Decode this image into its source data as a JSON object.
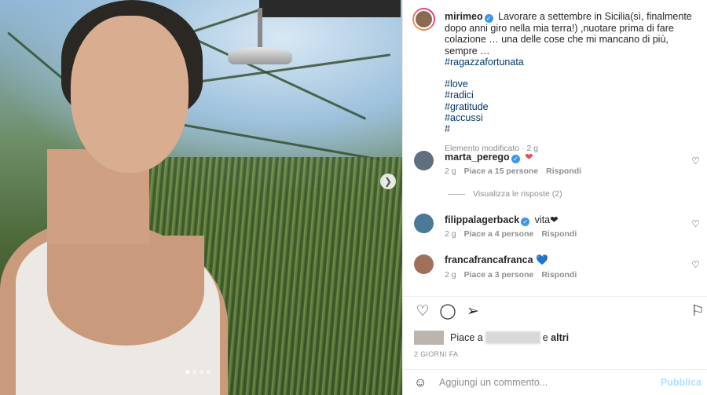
{
  "media": {
    "next_icon": "chevron-right-icon",
    "carousel": {
      "count": 4,
      "active_index": 0
    }
  },
  "caption": {
    "username": "mirimeo",
    "text": "Lavorare a settembre in Sicilia(sì, finalmente dopo anni giro nella mia terra!) ,nuotare prima di fare colazione … una delle cose che mi mancano di più, sempre …",
    "tag_main": "#ragazzafortunata",
    "hashtags": [
      "#love",
      "#radici",
      "#gratitude",
      "#accussi",
      "#"
    ],
    "edited": "Elemento modificato · 2 g"
  },
  "comments": [
    {
      "username": "marta_perego",
      "text": "❤",
      "time": "2 g",
      "likes": "Piace a 15 persone",
      "reply": "Rispondi"
    },
    {
      "username": "filippalagerback",
      "text": "vita❤",
      "time": "2 g",
      "likes": "Piace a 4 persone",
      "reply": "Rispondi"
    },
    {
      "username": "francafrancafranca",
      "text": "💙",
      "time": "2 g",
      "likes": "Piace a 3 persone",
      "reply": "Rispondi"
    }
  ],
  "view_replies": "Visualizza le risposte (2)",
  "actions": {
    "like_icon": "heart-icon",
    "comment_icon": "comment-icon",
    "share_icon": "send-icon",
    "save_icon": "bookmark-icon"
  },
  "likes_summary": {
    "prefix": "Piace a",
    "middle": "e",
    "suffix": "altri"
  },
  "posted": "2 GIORNI FA",
  "add_comment": {
    "placeholder": "Aggiungi un commento...",
    "publish": "Pubblica"
  },
  "colors": {
    "link": "#00376b",
    "verified": "#3897f0",
    "publish_disabled": "#b2dffc",
    "heart_red": "#ed4956"
  }
}
